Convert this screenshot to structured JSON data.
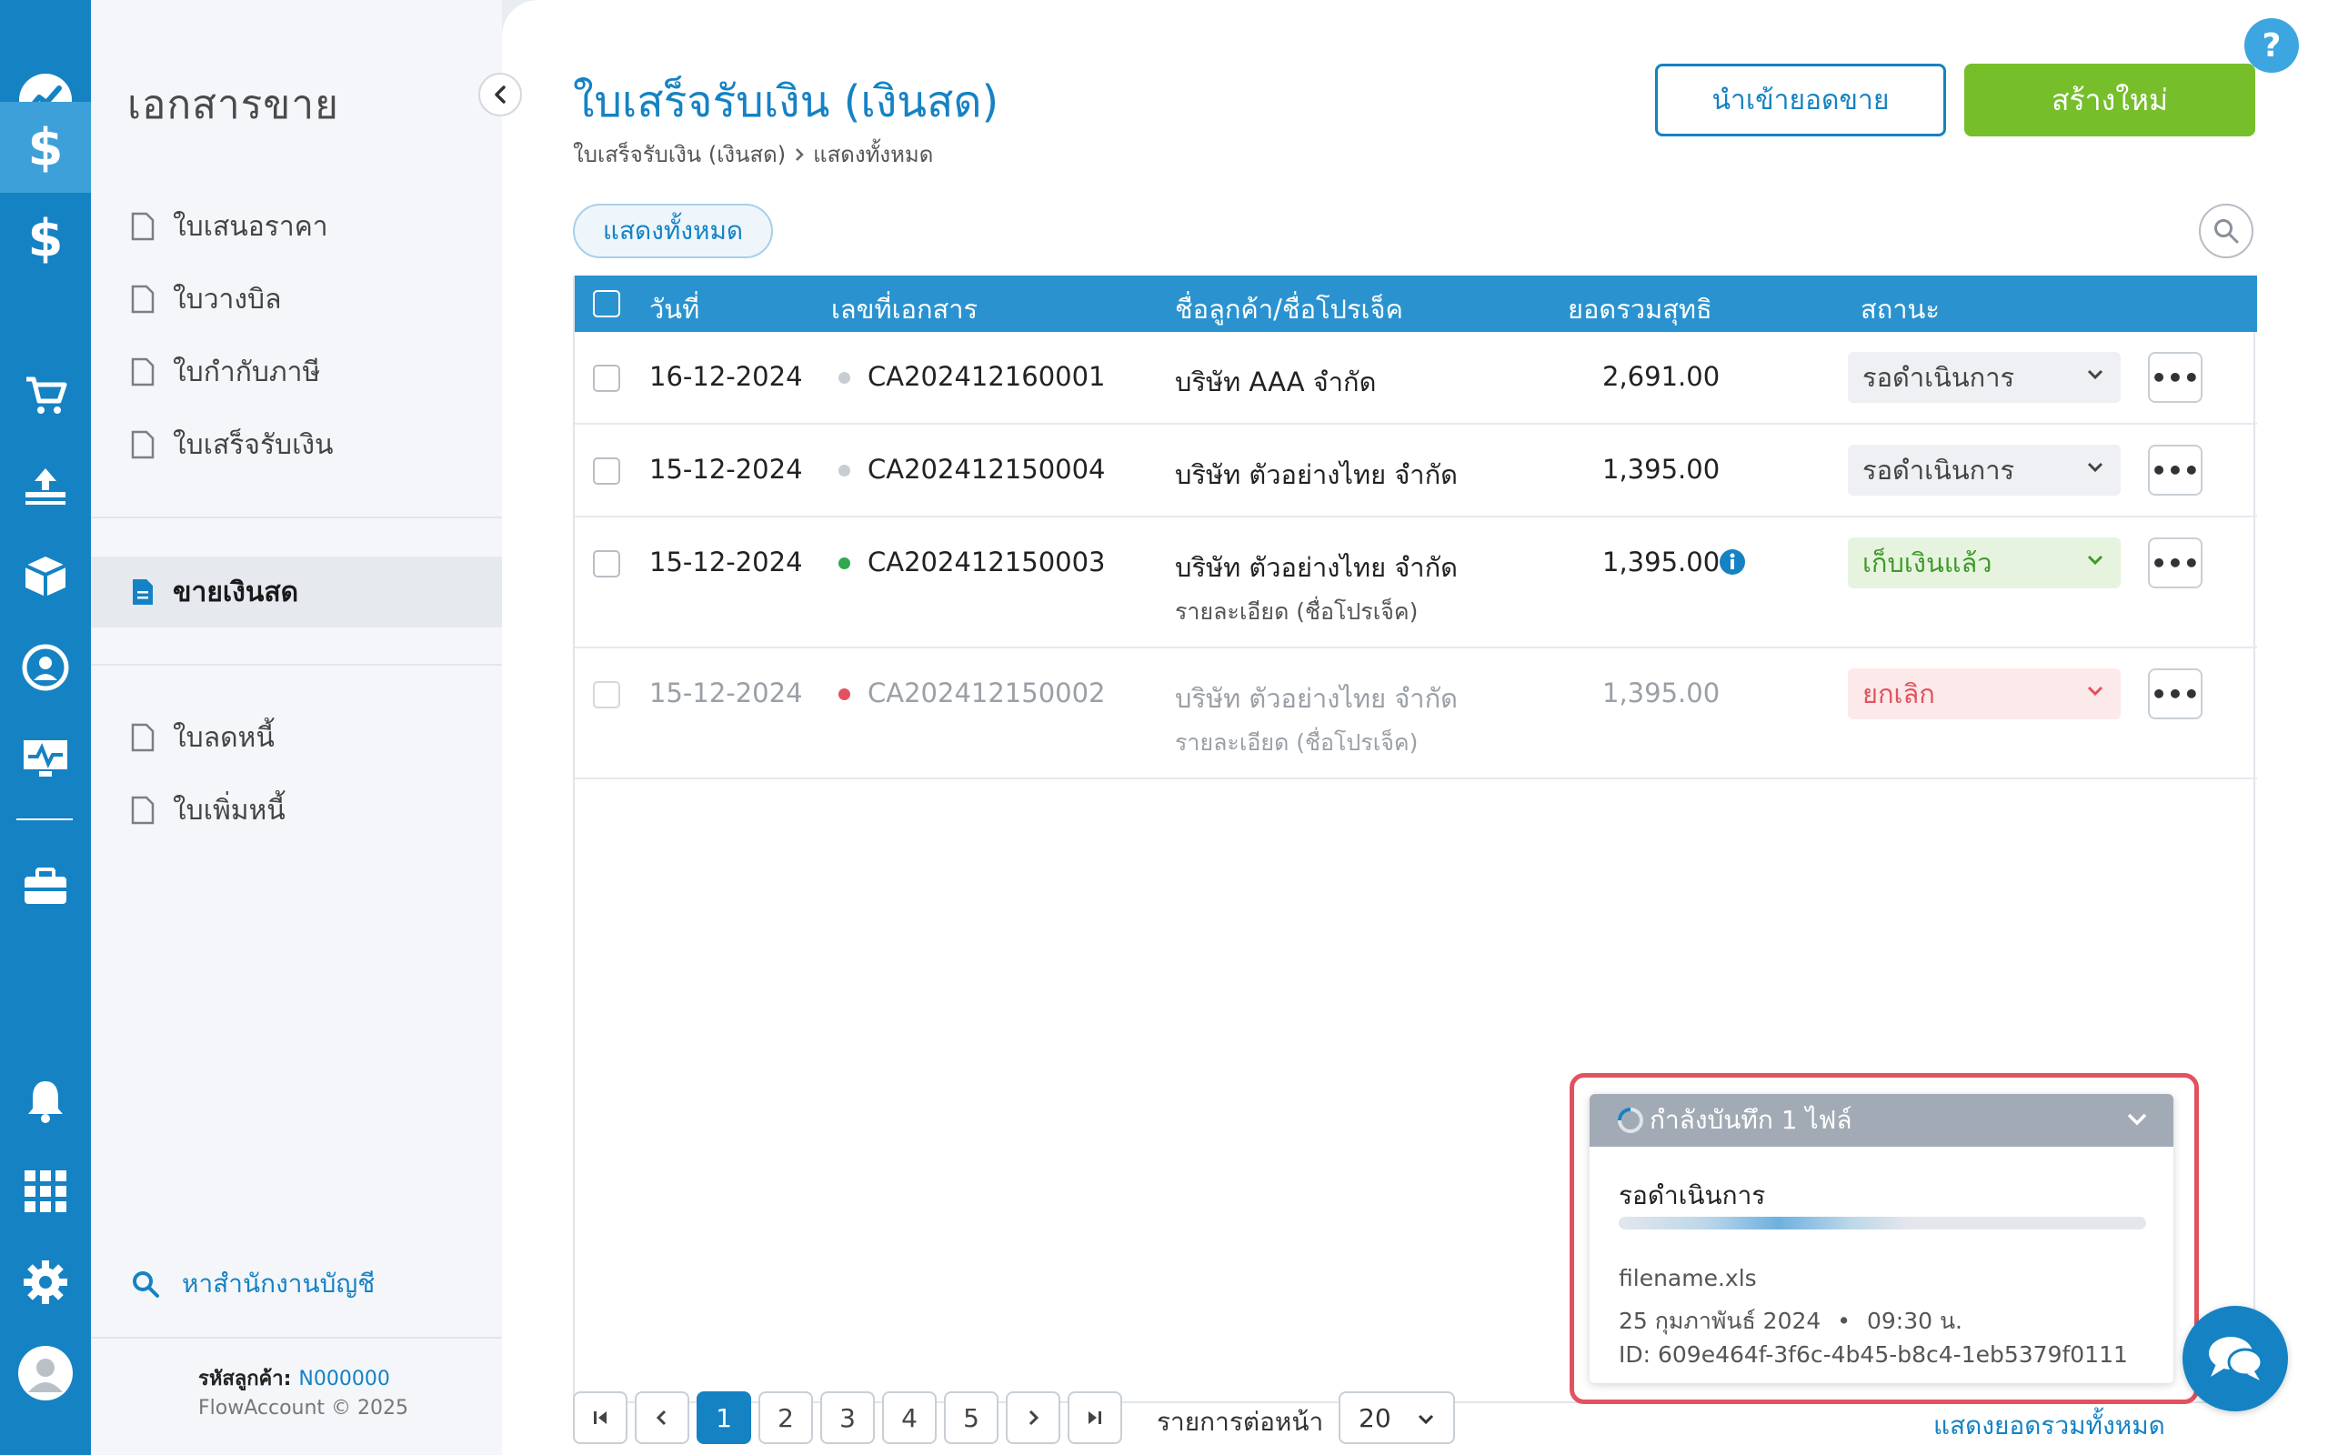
{
  "colors": {
    "brand": "#1582c4",
    "accent_green": "#76bf2b",
    "header_blue": "#2a93cf",
    "cancel_red": "#e2525e"
  },
  "rail": {
    "items": [
      {
        "icon": "dashboard-icon"
      },
      {
        "icon": "dollar-icon",
        "active": true
      },
      {
        "icon": "dollar-icon"
      },
      {
        "icon": "cart-icon"
      },
      {
        "icon": "inbox-tray-icon"
      },
      {
        "icon": "box-icon"
      },
      {
        "icon": "contact-icon"
      },
      {
        "icon": "monitor-icon"
      },
      {
        "icon": "briefcase-icon"
      },
      {
        "icon": "bell-icon"
      },
      {
        "icon": "apps-grid-icon"
      },
      {
        "icon": "gear-icon"
      },
      {
        "icon": "user-avatar-icon"
      }
    ]
  },
  "sidebar": {
    "title": "เอกสารขาย",
    "items": [
      "ใบเสนอราคา",
      "ใบวางบิล",
      "ใบกำกับภาษี",
      "ใบเสร็จรับเงิน"
    ],
    "active_item": "ขายเงินสด",
    "items_lower": [
      "ใบลดหนี้",
      "ใบเพิ่มหนี้"
    ],
    "search_label": "หาสำนักงานบัญชี",
    "customer_label": "รหัสลูกค้า:",
    "customer_code": "N000000",
    "copyright": "FlowAccount © 2025"
  },
  "header": {
    "title": "ใบเสร็จรับเงิน (เงินสด)",
    "breadcrumb_root": "ใบเสร็จรับเงิน (เงินสด)",
    "breadcrumb_current": "แสดงทั้งหมด",
    "import_label": "นำเข้ายอดขาย",
    "new_label": "สร้างใหม่",
    "help": "?"
  },
  "filter": {
    "chip_label": "แสดงทั้งหมด"
  },
  "table": {
    "columns": [
      "วันที่",
      "เลขที่เอกสาร",
      "ชื่อลูกค้า/ชื่อโปรเจ็ค",
      "ยอดรวมสุทธิ",
      "สถานะ"
    ],
    "rows": [
      {
        "date": "16-12-2024",
        "doc_no": "CA202412160001",
        "dot": "#c8cdd3",
        "customer": "บริษัท AAA จำกัด",
        "project": "",
        "total": "2,691.00",
        "status": "รอดำเนินการ",
        "info": false,
        "more": "•••"
      },
      {
        "date": "15-12-2024",
        "doc_no": "CA202412150004",
        "dot": "#c8cdd3",
        "customer": "บริษัท ตัวอย่างไทย จำกัด",
        "project": "",
        "total": "1,395.00",
        "status": "รอดำเนินการ",
        "info": false,
        "more": "•••"
      },
      {
        "date": "15-12-2024",
        "doc_no": "CA202412150003",
        "dot": "#2fa84f",
        "customer": "บริษัท ตัวอย่างไทย จำกัด",
        "project": "รายละเอียด (ชื่อโปรเจ็ค)",
        "total": "1,395.00",
        "status": "เก็บเงินแล้ว",
        "info": true,
        "more": "•••"
      },
      {
        "date": "15-12-2024",
        "doc_no": "CA202412150002",
        "dot": "#e2525e",
        "customer": "บริษัท ตัวอย่างไทย จำกัด",
        "project": "รายละเอียด (ชื่อโปรเจ็ค)",
        "total": "1,395.00",
        "status": "ยกเลิก",
        "info": false,
        "more": "•••"
      }
    ]
  },
  "pagination": {
    "pages": [
      "1",
      "2",
      "3",
      "4",
      "5"
    ],
    "current": "1",
    "per_page_label": "รายการต่อหน้า",
    "per_page_value": "20",
    "show_totals_label": "แสดงยอดรวมทั้งหมด"
  },
  "upload_toast": {
    "title": "กำลังบันทึก 1 ไฟล์",
    "status": "รอดำเนินการ",
    "progress": 0.55,
    "filename": "filename.xls",
    "date": "25 กุมภาพันธ์ 2024",
    "bullet": "•",
    "time": "09:30 น.",
    "id_line": "ID: 609e464f-3f6c-4b45-b8c4-1eb5379f0111"
  }
}
